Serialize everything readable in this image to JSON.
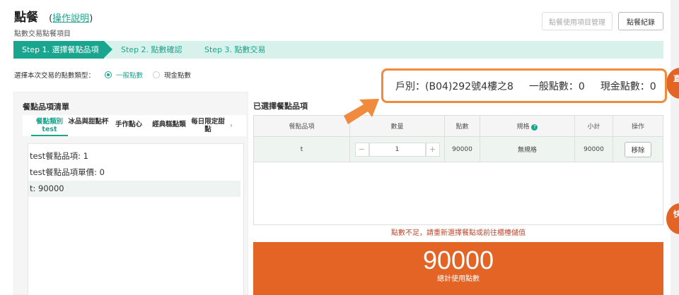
{
  "header": {
    "title": "點餐",
    "help_open": "(",
    "help_link": "操作說明",
    "help_close": ")",
    "subtitle": "點數交易點餐項目",
    "manage_button": "點餐使用項目管理",
    "records_button": "點餐紀錄"
  },
  "steps": {
    "step1": "Step 1. 選擇餐點品項",
    "step2": "Step 2. 點數確認",
    "step3": "Step 3. 點數交易"
  },
  "point_type": {
    "label": "選擇本次交易的點數類型：",
    "option_general": "一般點數",
    "option_cash": "現金點數",
    "selected": "一般點數"
  },
  "menu_list": {
    "title": "餐點品項清單",
    "tabs": [
      {
        "label": "餐點類別 test"
      },
      {
        "label": "冰品與甜點杯"
      },
      {
        "label": "手作點心"
      },
      {
        "label": "經典糕點類"
      },
      {
        "label": "每日限定甜點"
      }
    ],
    "next_arrow": "›",
    "items": [
      "test餐點品項: 1",
      "test餐點品項單價: 0",
      "t: 90000"
    ]
  },
  "selected": {
    "title": "已選擇餐點品項",
    "headers": [
      "餐點品項",
      "數量",
      "點數",
      "規格",
      "小計",
      "操作"
    ],
    "spec_help_icon": "question-circle-icon",
    "rows": [
      {
        "item": "t",
        "qty": "1",
        "points": "90000",
        "spec": "無規格",
        "subtotal": "90000",
        "action": "移除"
      }
    ],
    "minus": "−",
    "plus": "+",
    "warning": "點數不足，請重新選擇餐點或前往櫃檯儲值",
    "total": "90000",
    "total_label": "總計使用點數"
  },
  "callout": {
    "account": "戶別：(B04)292號4樓之8",
    "general": "一般點數：0",
    "cash": "現金點數：0"
  },
  "side": {
    "badge1": "直 變",
    "badge2": "快 發"
  },
  "colors": {
    "accent": "#1aa58e",
    "orange": "#e46426",
    "callout_border": "#f08a3c"
  }
}
